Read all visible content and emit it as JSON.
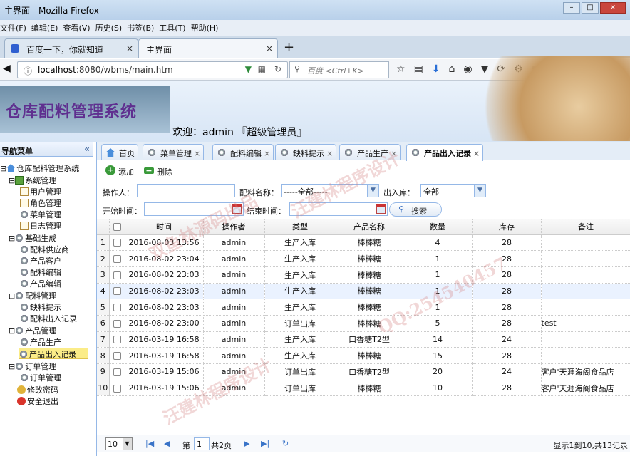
{
  "window": {
    "title": "主界面 - Mozilla Firefox",
    "controls": [
      "–",
      "□",
      "×"
    ]
  },
  "menubar": [
    "文件(F)",
    "编辑(E)",
    "查看(V)",
    "历史(S)",
    "书签(B)",
    "工具(T)",
    "帮助(H)"
  ],
  "browser_tabs": [
    {
      "label": "百度一下，你就知道"
    },
    {
      "label": "主界面"
    }
  ],
  "new_tab": "+",
  "url": {
    "host": "localhost",
    "rest": ":8080/wbms/main.htm"
  },
  "search": {
    "placeholder": "百度 <Ctrl+K>"
  },
  "app": {
    "title": "仓库配料管理系统",
    "welcome": "欢迎：admin 『超级管理员』"
  },
  "sidebar": {
    "title": "导航菜单",
    "collapse": "«",
    "root": "仓库配料管理系统",
    "groups": [
      {
        "label": "系统管理",
        "items": [
          "用户管理",
          "角色管理",
          "菜单管理",
          "日志管理"
        ]
      },
      {
        "label": "基础生成",
        "items": [
          "配料供应商",
          "产品客户",
          "配料编辑",
          "产品编辑"
        ]
      },
      {
        "label": "配料管理",
        "items": [
          "缺料提示",
          "配料出入记录"
        ]
      },
      {
        "label": "产品管理",
        "items": [
          "产品生产",
          "产品出入记录"
        ]
      },
      {
        "label": "订单管理",
        "items": [
          "订单管理"
        ]
      }
    ],
    "extra": [
      "修改密码",
      "安全退出"
    ],
    "selected": "产品出入记录"
  },
  "tabs": [
    {
      "label": "首页"
    },
    {
      "label": "菜单管理"
    },
    {
      "label": "配料编辑"
    },
    {
      "label": "缺料提示"
    },
    {
      "label": "产品生产"
    },
    {
      "label": "产品出入记录"
    }
  ],
  "toolbar": {
    "add": "添加",
    "delete": "删除"
  },
  "filters": {
    "operator_label": "操作人：",
    "operator_value": "",
    "product_label": "配料名称：",
    "product_value": "-----全部-----",
    "inout_label": "出入库：",
    "inout_value": "全部",
    "start_label": "开始时间：",
    "end_label": "结束时间：",
    "search_button": "搜索"
  },
  "table": {
    "headers": [
      "",
      "时间",
      "操作者",
      "类型",
      "产品名称",
      "数量",
      "库存",
      "备注"
    ],
    "rows": [
      [
        "1",
        "2016-08-03 13:56",
        "admin",
        "生产入库",
        "棒棒糖",
        "4",
        "28",
        ""
      ],
      [
        "2",
        "2016-08-02 23:04",
        "admin",
        "生产入库",
        "棒棒糖",
        "1",
        "28",
        ""
      ],
      [
        "3",
        "2016-08-02 23:03",
        "admin",
        "生产入库",
        "棒棒糖",
        "1",
        "28",
        ""
      ],
      [
        "4",
        "2016-08-02 23:03",
        "admin",
        "生产入库",
        "棒棒糖",
        "1",
        "28",
        ""
      ],
      [
        "5",
        "2016-08-02 23:03",
        "admin",
        "生产入库",
        "棒棒糖",
        "1",
        "28",
        ""
      ],
      [
        "6",
        "2016-08-02 23:00",
        "admin",
        "订单出库",
        "棒棒糖",
        "5",
        "28",
        "test"
      ],
      [
        "7",
        "2016-03-19 16:58",
        "admin",
        "生产入库",
        "口香糖T2型",
        "14",
        "24",
        ""
      ],
      [
        "8",
        "2016-03-19 16:58",
        "admin",
        "生产入库",
        "棒棒糖",
        "15",
        "28",
        ""
      ],
      [
        "9",
        "2016-03-19 15:06",
        "admin",
        "订单出库",
        "口香糖T2型",
        "20",
        "24",
        "客户'天涯海阁食品店"
      ],
      [
        "10",
        "2016-03-19 15:06",
        "admin",
        "订单出库",
        "棒棒糖",
        "10",
        "28",
        "客户'天涯海阁食品店"
      ]
    ]
  },
  "pager": {
    "page_size": "10",
    "page_prefix": "第",
    "page": "1",
    "page_suffix": "共2页",
    "summary": "显示1到10,共13记录"
  },
  "watermarks": [
    "双鱼林源码出品",
    "QQ:254540457",
    "汪建林程序设计"
  ]
}
